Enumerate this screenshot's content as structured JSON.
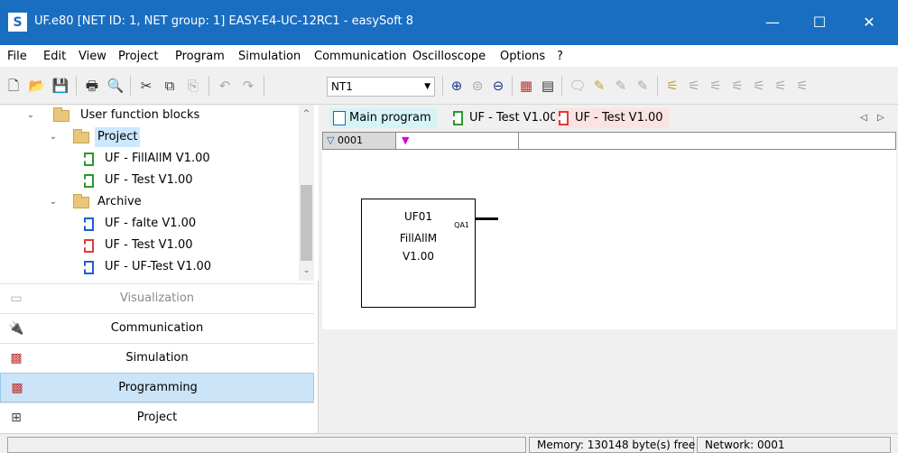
{
  "titlebar": {
    "icon_glyph": "S",
    "title": "UF.e80 [NET ID: 1, NET group: 1] EASY-E4-UC-12RC1 - easySoft 8",
    "minimize": "—",
    "maximize": "☐",
    "close": "✕"
  },
  "menu": [
    "File",
    "Edit",
    "View",
    "Project",
    "Program",
    "Simulation",
    "Communication",
    "Oscilloscope",
    "Options",
    "?"
  ],
  "toolbar": {
    "network_select": "NT1",
    "icons": [
      "new-file-icon",
      "open-folder-icon",
      "save-icon",
      "print-icon",
      "print-preview-icon",
      "cut-icon",
      "copy-icon",
      "paste-icon",
      "undo-icon",
      "redo-icon",
      "zoom-in-icon",
      "zoom-reset-icon",
      "zoom-out-icon",
      "network-delete-icon",
      "network-view-icon",
      "comment-icon",
      "tool-1-icon",
      "tool-2-icon",
      "tool-3-icon",
      "tool-4-icon",
      "tool-5-icon",
      "tool-6-icon",
      "tool-7-icon",
      "tool-8-icon",
      "tool-9-icon"
    ]
  },
  "tree": {
    "root": "User function blocks",
    "project_folder": "Project",
    "project_items": [
      "UF - FillAllM V1.00",
      "UF - Test V1.00"
    ],
    "archive_folder": "Archive",
    "archive_items": [
      "UF - falte V1.00",
      "UF - Test V1.00",
      "UF - UF-Test V1.00"
    ]
  },
  "nav": {
    "visualization": "Visualization",
    "communication": "Communication",
    "simulation": "Simulation",
    "programming": "Programming",
    "project": "Project"
  },
  "tabs": [
    "Main program",
    "UF - Test V1.00",
    "UF - Test V1.00"
  ],
  "tab_nav": {
    "prev": "◁",
    "next": "▷"
  },
  "network": {
    "number": "0001",
    "marker": "▼"
  },
  "function_block": {
    "name": "UF01",
    "type": "FillAllM",
    "version": "V1.00",
    "output_port": "QA1"
  },
  "status": {
    "memory": "Memory: 130148 byte(s) free",
    "network": "Network: 0001"
  },
  "colors": {
    "titlebar": "#1a6ec1",
    "active_nav": "#cce4f7",
    "main_tab": "#d6f3f6",
    "uf_tab": "#fbe3e3",
    "marker": "#d400d4"
  }
}
